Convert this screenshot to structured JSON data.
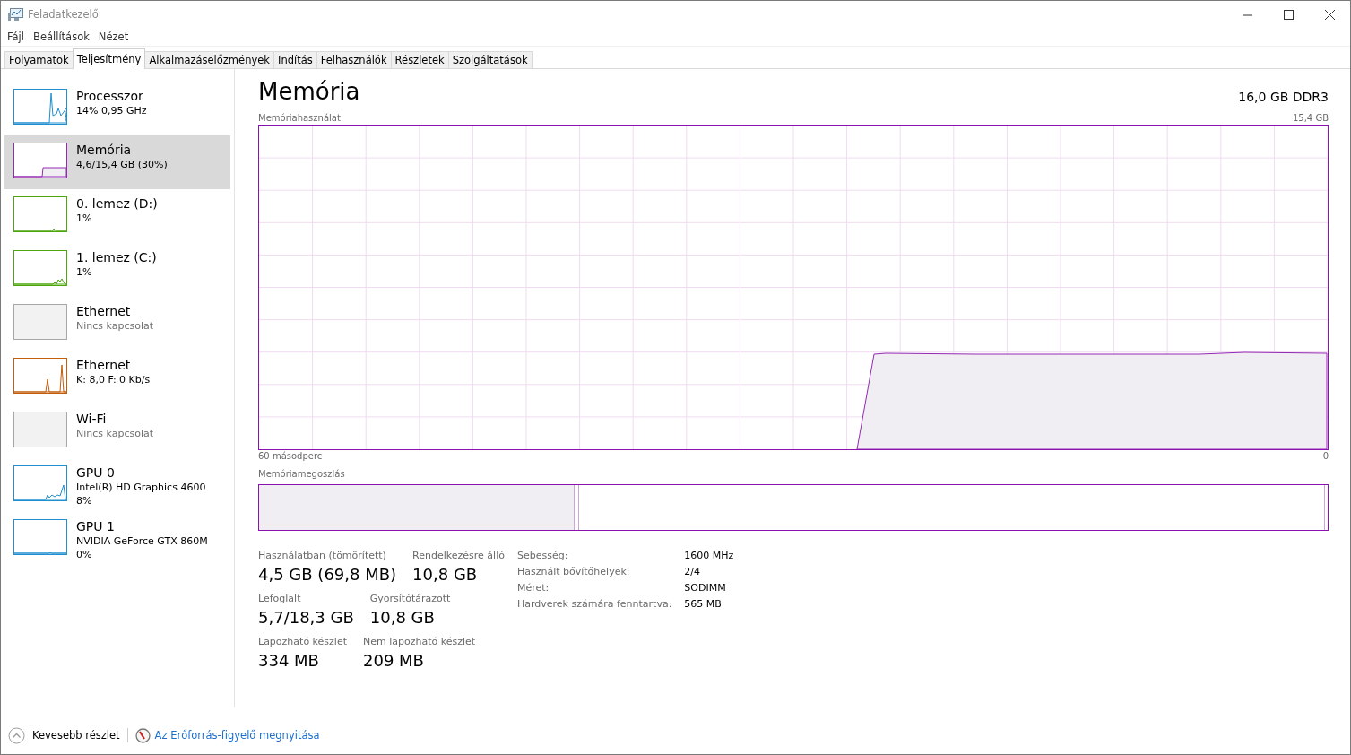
{
  "window": {
    "title": "Feladatkezelő"
  },
  "menu": [
    "Fájl",
    "Beállítások",
    "Nézet"
  ],
  "tabs": [
    {
      "label": "Folyamatok",
      "selected": false
    },
    {
      "label": "Teljesítmény",
      "selected": true
    },
    {
      "label": "Alkalmazáselőzmények",
      "selected": false
    },
    {
      "label": "Indítás",
      "selected": false
    },
    {
      "label": "Felhasználók",
      "selected": false
    },
    {
      "label": "Részletek",
      "selected": false
    },
    {
      "label": "Szolgáltatások",
      "selected": false
    }
  ],
  "sidebar": {
    "items": [
      {
        "name": "Processzor",
        "lines": [
          "14%  0,95 GHz"
        ],
        "color": "#1f8fcf",
        "connected": true,
        "selected": false
      },
      {
        "name": "Memória",
        "lines": [
          "4,6/15,4 GB (30%)"
        ],
        "color": "#9528b4",
        "connected": true,
        "selected": true
      },
      {
        "name": "0. lemez (D:)",
        "lines": [
          "1%"
        ],
        "color": "#4da60c",
        "connected": true,
        "selected": false
      },
      {
        "name": "1. lemez (C:)",
        "lines": [
          "1%"
        ],
        "color": "#4da60c",
        "connected": true,
        "selected": false
      },
      {
        "name": "Ethernet",
        "lines": [
          "Nincs kapcsolat"
        ],
        "color": "#a7a7a7",
        "connected": false,
        "selected": false
      },
      {
        "name": "Ethernet",
        "lines": [
          "K: 8,0 F: 0 Kb/s"
        ],
        "color": "#c25e0a",
        "connected": true,
        "selected": false
      },
      {
        "name": "Wi-Fi",
        "lines": [
          "Nincs kapcsolat"
        ],
        "color": "#a7a7a7",
        "connected": false,
        "selected": false
      },
      {
        "name": "GPU 0",
        "lines": [
          "Intel(R) HD Graphics 4600",
          "8%"
        ],
        "color": "#1f8fcf",
        "connected": true,
        "selected": false
      },
      {
        "name": "GPU 1",
        "lines": [
          "NVIDIA GeForce GTX 860M",
          "0%"
        ],
        "color": "#1f8fcf",
        "connected": true,
        "selected": false
      }
    ]
  },
  "panel": {
    "title": "Memória",
    "spec": "16,0 GB DDR3",
    "usage_graph": {
      "title": "Memóriahasználat",
      "max_label": "15,4 GB",
      "time_span": "60 másodperc",
      "min_label": "0"
    },
    "composition_title": "Memóriamegoszlás",
    "stats": [
      {
        "label": "Használatban (tömörített)",
        "value": "4,5 GB (69,8 MB)"
      },
      {
        "label": "Rendelkezésre álló",
        "value": "10,8 GB"
      },
      {
        "label": "Lefoglalt",
        "value": "5,7/18,3 GB"
      },
      {
        "label": "Gyorsítótárazott",
        "value": "10,8 GB"
      },
      {
        "label": "Lapozható készlet",
        "value": "334 MB"
      },
      {
        "label": "Nem lapozható készlet",
        "value": "209 MB"
      }
    ],
    "properties": [
      {
        "label": "Sebesség:",
        "value": "1600 MHz"
      },
      {
        "label": "Használt bővítőhelyek:",
        "value": "2/4"
      },
      {
        "label": "Méret:",
        "value": "SODIMM"
      },
      {
        "label": "Hardverek számára fenntartva:",
        "value": "565 MB"
      }
    ]
  },
  "footer": {
    "less_details": "Kevesebb részlet",
    "link": "Az Erőforrás-figyelő megnyitása"
  }
}
